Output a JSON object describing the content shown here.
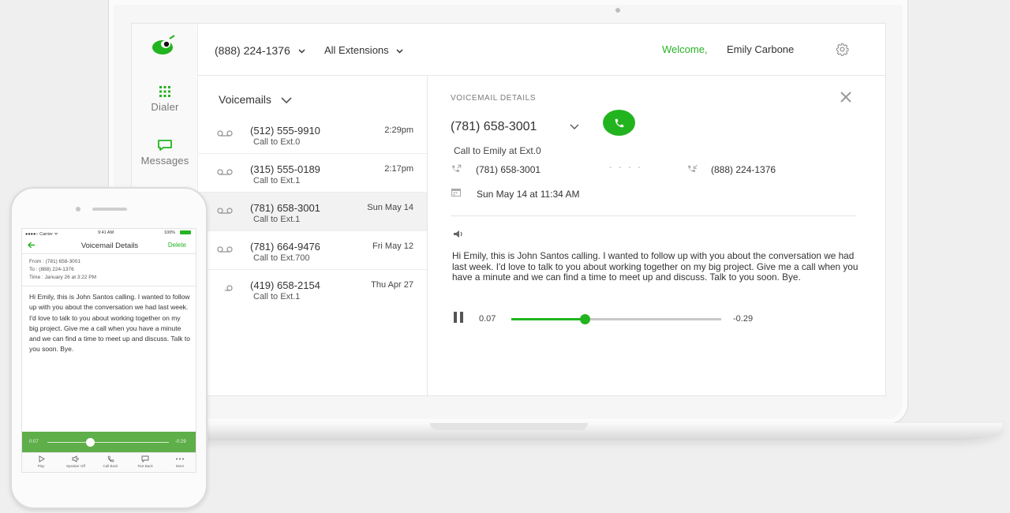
{
  "colors": {
    "accent": "#22b41f",
    "accent_text": "#27b324",
    "player_bar": "#5eae49"
  },
  "nav": {
    "logo": "grasshopper-logo",
    "items": [
      {
        "label": "Dialer",
        "icon": "dialpad-icon"
      },
      {
        "label": "Messages",
        "icon": "message-bubble-icon"
      }
    ]
  },
  "header": {
    "phone_number": "(888) 224-1376",
    "extensions": "All Extensions",
    "welcome": "Welcome,",
    "user_name": "Emily Carbone",
    "settings_icon": "gear-icon"
  },
  "list": {
    "title": "Voicemails",
    "items": [
      {
        "number": "(512) 555-9910",
        "subtitle": "Call to Ext.0",
        "time": "2:29pm",
        "selected": false
      },
      {
        "number": "(315) 555-0189",
        "subtitle": "Call to Ext.1",
        "time": "2:17pm",
        "selected": false
      },
      {
        "number": "(781) 658-3001",
        "subtitle": "Call to Ext.1",
        "time": "Sun May 14",
        "selected": true
      },
      {
        "number": "(781) 664-9476",
        "subtitle": "Call to Ext.700",
        "time": "Fri May 12",
        "selected": false
      },
      {
        "number": "(419) 658-2154",
        "subtitle": "Call to Ext.1",
        "time": "Thu Apr 27",
        "selected": false
      }
    ]
  },
  "detail": {
    "section_label": "VOICEMAIL DETAILS",
    "number": "(781) 658-3001",
    "call_to": "Call to Emily at Ext.0",
    "from_number": "(781) 658-3001",
    "dashes": "- - - -",
    "to_number": "(888) 224-1376",
    "date": "Sun May 14 at 11:34 AM",
    "transcript": "Hi Emily, this is John Santos calling. I wanted to follow up with you about the conversation we had last week. I'd love to talk to you about working together on my big project. Give me a call when you have a minute and we can find a time to meet up and discuss. Talk to you soon. Bye.",
    "player": {
      "current": "0.07",
      "remaining": "-0.29",
      "progress": 0.35
    }
  },
  "mobile": {
    "status": {
      "carrier": "●●●●○ Carrier ᯤ",
      "time": "9:41 AM",
      "battery": "100%"
    },
    "title": "Voicemail Details",
    "delete_label": "Delete",
    "meta": {
      "from": "From : (781) 658-3001",
      "to": "To   :  (888) 224-1376",
      "time": "Time : January 26 at 3:22 PM"
    },
    "transcript": "Hi Emily, this is John Santos calling. I wanted to follow up with you about the conversation we had last week. I'd love to talk to you about working together on my big project. Give me a call when you have a minute and we can find a time to meet up and discuss. Talk to you soon. Bye.",
    "player": {
      "current": "0:07",
      "remaining": "-0:29",
      "progress": 0.35
    },
    "tabs": [
      {
        "label": "Play",
        "icon": "play-icon"
      },
      {
        "label": "Speaker Off",
        "icon": "speaker-icon"
      },
      {
        "label": "Call Back",
        "icon": "phone-icon"
      },
      {
        "label": "Text Back",
        "icon": "chat-icon"
      },
      {
        "label": "More",
        "icon": "more-icon"
      }
    ]
  }
}
